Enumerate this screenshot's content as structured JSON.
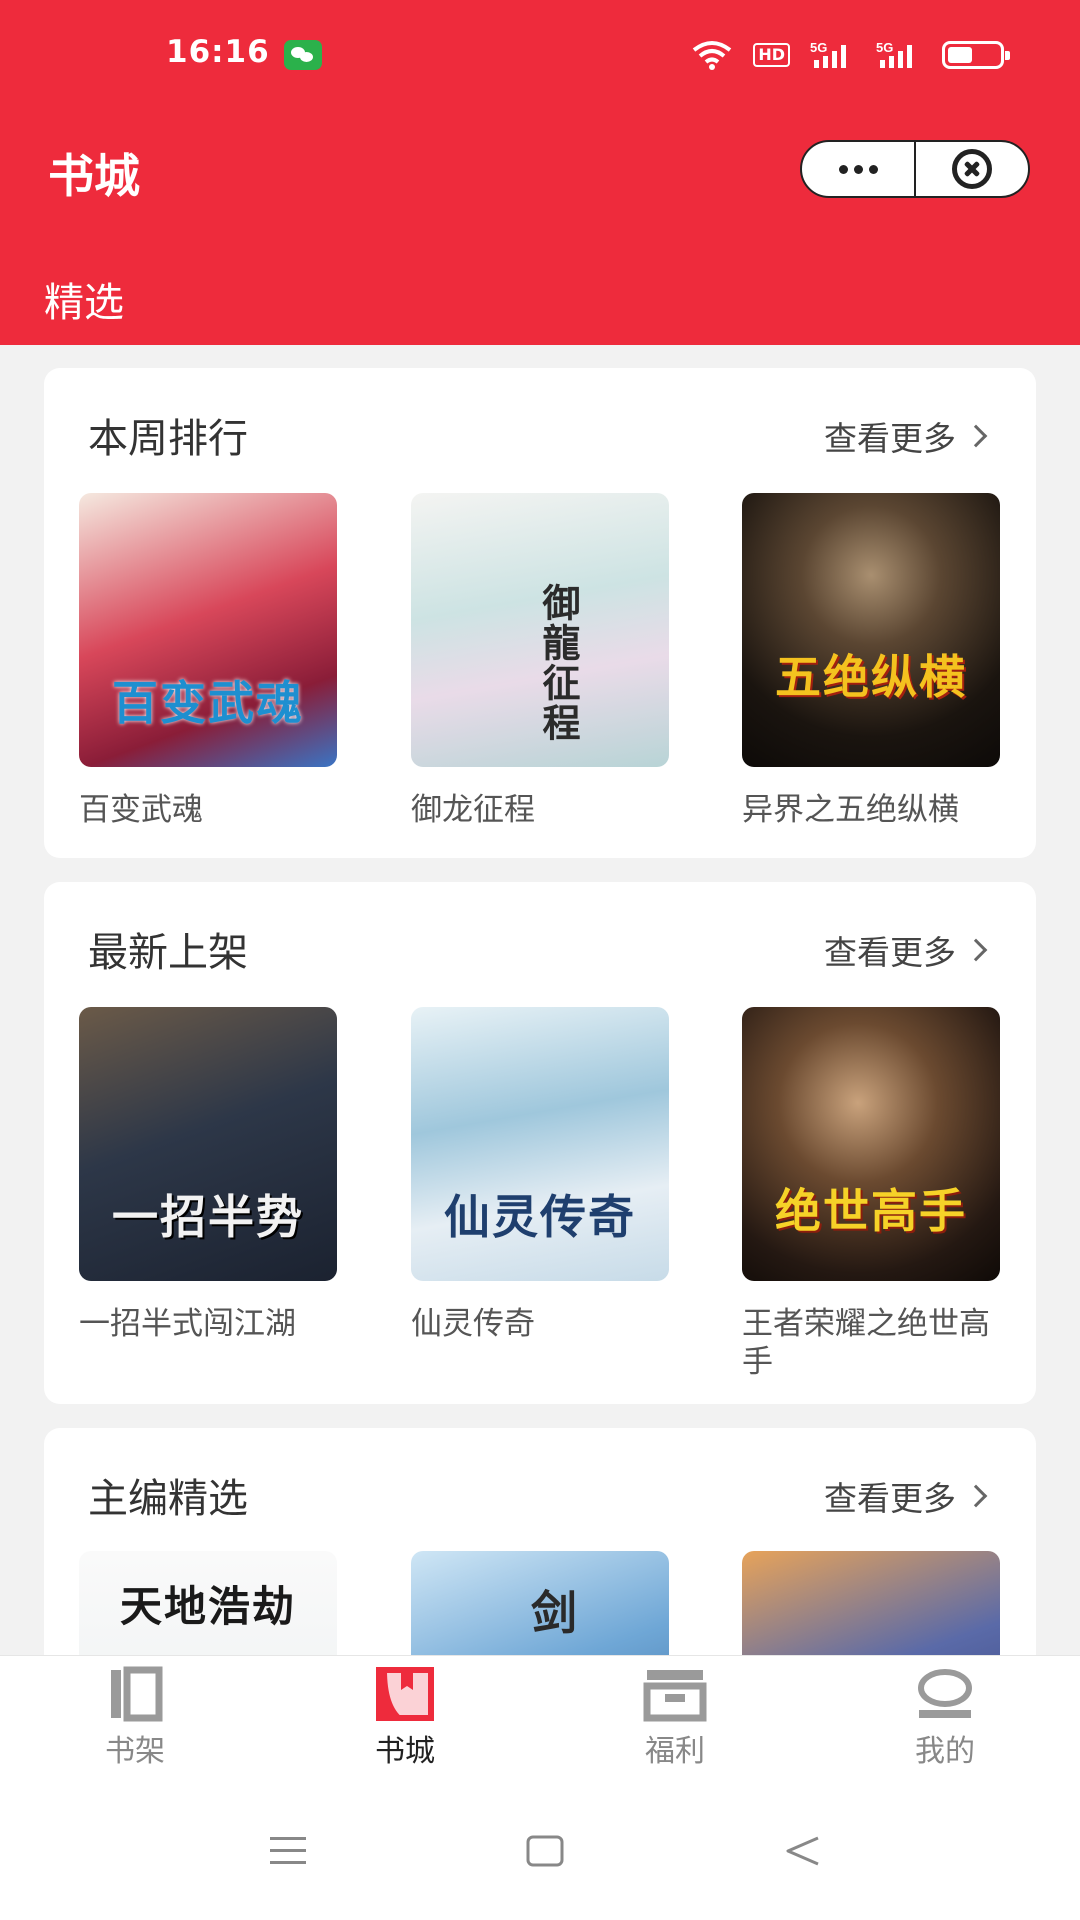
{
  "status_bar": {
    "time": "16:16",
    "hd_label": "HD",
    "signal_label": "5G"
  },
  "header": {
    "title": "书城",
    "capsule": {
      "menu_icon": "more-dots-icon",
      "close_icon": "close-circle-icon"
    },
    "active_tab": "精选"
  },
  "sections": [
    {
      "title": "本周排行",
      "more": "查看更多",
      "books": [
        {
          "name": "百变武魂",
          "cover_text": "百变武魂",
          "cover_color": "#c8304a"
        },
        {
          "name": "御龙征程",
          "cover_text": "御龍征程",
          "cover_color": "#bfd8d8"
        },
        {
          "name": "异界之五绝纵横",
          "cover_text": "五绝纵横",
          "cover_color": "#2a1f18"
        }
      ]
    },
    {
      "title": "最新上架",
      "more": "查看更多",
      "books": [
        {
          "name": "一招半式闯江湖",
          "cover_text": "一招半势",
          "cover_color": "#2d3748"
        },
        {
          "name": "仙灵传奇",
          "cover_text": "仙灵传奇",
          "cover_color": "#cfe4ef"
        },
        {
          "name": "王者荣耀之绝世高手",
          "cover_text": "绝世高手",
          "cover_color": "#3b2a1e"
        }
      ]
    },
    {
      "title": "主编精选",
      "more": "查看更多",
      "books": [
        {
          "name": "",
          "cover_text": "天地浩劫",
          "cover_color": "#f3f3f3"
        },
        {
          "name": "",
          "cover_text": "剑",
          "cover_color": "#7fb3dc"
        },
        {
          "name": "",
          "cover_text": "",
          "cover_color": "#5a6aa8"
        }
      ]
    }
  ],
  "tabbar": [
    {
      "label": "书架",
      "icon": "bookshelf-icon",
      "active": false
    },
    {
      "label": "书城",
      "icon": "bookstore-icon",
      "active": true
    },
    {
      "label": "福利",
      "icon": "gift-icon",
      "active": false
    },
    {
      "label": "我的",
      "icon": "profile-icon",
      "active": false
    }
  ],
  "colors": {
    "brand_red": "#ee2b3c",
    "tab_inactive": "#888888",
    "tab_active": "#222222"
  }
}
